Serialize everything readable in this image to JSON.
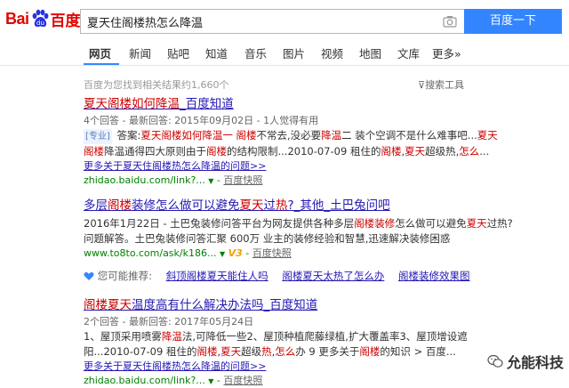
{
  "logo": {
    "part1": "Bai",
    "part2": "百度"
  },
  "search": {
    "query": "夏天住阁楼热怎么降温",
    "button": "百度一下"
  },
  "tabs": [
    "网页",
    "新闻",
    "贴吧",
    "知道",
    "音乐",
    "图片",
    "视频",
    "地图",
    "文库",
    "更多»"
  ],
  "result_count": "百度为您找到相关结果约1,660个",
  "tools": "搜索工具",
  "results": [
    {
      "title_a": "夏天阁楼",
      "title_b": "如何",
      "title_c": "降温",
      "title_d": "_百度知道",
      "meta": "4个回答 - 最新回答: 2015年09月02日 - 1人觉得有用",
      "tag": "[专业]",
      "abs1_a": " 答案:",
      "abs1_b": "夏天阁楼如何降温一 阁楼",
      "abs1_c": "不常去,没必要",
      "abs1_d": "降温",
      "abs1_e": "二 装个空调不是什么难事吧...",
      "abs1_f": "夏天",
      "abs2_a": "阁楼",
      "abs2_b": "降温通得四大原则由于",
      "abs2_c": "阁楼",
      "abs2_d": "的结构限制...2010-07-09 租住的",
      "abs2_e": "阁楼",
      "abs2_f": ",",
      "abs2_g": "夏天",
      "abs2_h": "超级热,",
      "abs2_i": "怎么",
      "abs2_j": "...",
      "more": "更多关于夏天住阁楼热怎么降温的问题>>",
      "url": "zhidao.baidu.com/link?...",
      "snap": "百度快照"
    },
    {
      "title_a": "多层",
      "title_b": "阁楼",
      "title_c": "装修怎么做可以避免",
      "title_d": "夏天",
      "title_e": "过",
      "title_f": "热",
      "title_g": "?_其他_土巴兔问吧",
      "l1_a": "2016年1月22日 - 土巴兔装修问答平台为网友提供各种多层",
      "l1_b": "阁楼",
      "l1_c": "装修",
      "l1_d": "怎么做可以避免",
      "l1_e": "夏天",
      "l1_f": "过热?",
      "l2": "问题解答。土巴兔装修问答汇聚 600万 业主的装修经验和智慧,迅速解决装修困惑",
      "url": "www.to8to.com/ask/k186...",
      "badge": "V3",
      "snap": "百度快照"
    },
    {
      "title_a": "阁楼夏天",
      "title_b": "温度高有什么解决办法吗_百度知道",
      "meta": "2个回答 - 最新回答: 2017年05月24日",
      "l1_a": "1、屋顶采用喷雾",
      "l1_b": "降温",
      "l1_c": "法,可降低一些2、屋顶种植爬藤绿植,扩大覆盖率3、屋顶增设遮",
      "l2_a": "阳...2010-07-09 租住的",
      "l2_b": "阁楼",
      "l2_c": ",",
      "l2_d": "夏天",
      "l2_e": "超级",
      "l2_f": "热",
      "l2_g": ",",
      "l2_h": "怎么",
      "l2_i": "办 9 更多关于",
      "l2_j": "阁楼",
      "l2_k": "的知识 > 百度...",
      "more": "更多关于夏天住阁楼热怎么降温的问题>>",
      "url": "zhidao.baidu.com/link?...",
      "snap": "百度快照"
    }
  ],
  "recommend": {
    "label": "您可能推荐:",
    "items": [
      "斜顶阁楼夏天能住人吗",
      "阁楼夏天太热了怎么办",
      "阁楼装修效果图"
    ]
  },
  "watermark": "允能科技",
  "colors": {
    "brand_red": "#e10601",
    "button_blue": "#3385ff",
    "link": "#2518b5",
    "highlight": "#cc0000",
    "url_green": "#008000"
  }
}
